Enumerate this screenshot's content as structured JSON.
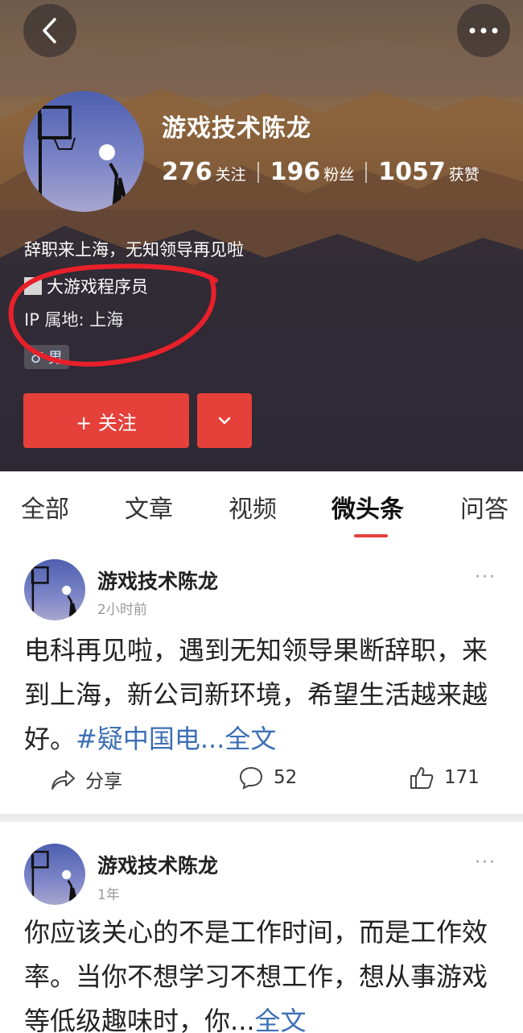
{
  "header": {
    "nickname": "游戏技术陈龙",
    "stats": [
      {
        "num": "276",
        "label": "关注"
      },
      {
        "num": "196",
        "label": "粉丝"
      },
      {
        "num": "1057",
        "label": "获赞"
      }
    ],
    "bio": "辞职来上海，无知领导再见啦",
    "cert": "大游戏程序员",
    "ip": "IP 属地: 上海",
    "gender": "♂ 男",
    "follow_label": "+ 关注",
    "icons": {
      "back": "chevron-left-icon",
      "more": "more-dots-icon",
      "dropdown": "chevron-down-icon"
    },
    "accent": "#e5403a"
  },
  "tabs": [
    {
      "label": "全部"
    },
    {
      "label": "文章"
    },
    {
      "label": "视频"
    },
    {
      "label": "微头条",
      "active": true
    },
    {
      "label": "问答"
    }
  ],
  "posts": [
    {
      "author": "游戏技术陈龙",
      "time": "2小时前",
      "text": "电科再见啦，遇到无知领导果断辞职，来到上海，新公司新环境，希望生活越来越好。",
      "hashtag": "#疑中国电",
      "ellipsis": "...",
      "more": "全文",
      "share_label": "分享",
      "comments": "52",
      "likes": "171"
    },
    {
      "author": "游戏技术陈龙",
      "time": "1年",
      "text": "你应该关心的不是工作时间，而是工作效率。当你不想学习不想工作，想从事游戏等低级趣味时，你",
      "ellipsis": "...",
      "more": "全文"
    }
  ]
}
